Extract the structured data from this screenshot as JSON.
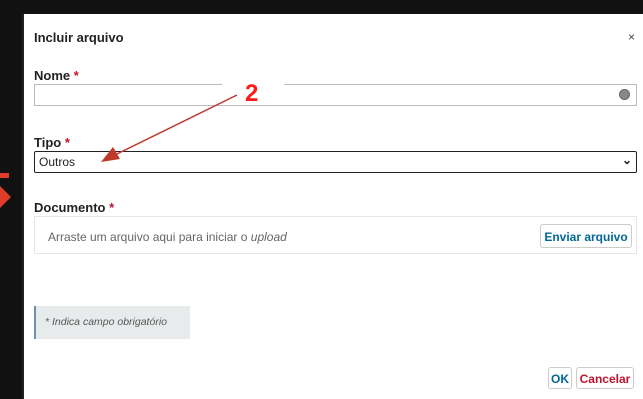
{
  "dialog": {
    "title": "Incluir arquivo",
    "close_label": "×"
  },
  "fields": {
    "name": {
      "label": "Nome",
      "required_mark": "*",
      "value": ""
    },
    "type": {
      "label": "Tipo",
      "required_mark": "*",
      "selected": "Outros"
    },
    "document": {
      "label": "Documento",
      "required_mark": "*",
      "drop_text_prefix": "Arraste um arquivo aqui para iniciar o ",
      "drop_text_italic": "upload",
      "upload_button": "Enviar arquivo"
    }
  },
  "note": "* Indica campo obrigatório",
  "buttons": {
    "ok": "OK",
    "cancel": "Cancelar"
  },
  "annotation": {
    "number": "2",
    "color": "#ff1a1a"
  }
}
